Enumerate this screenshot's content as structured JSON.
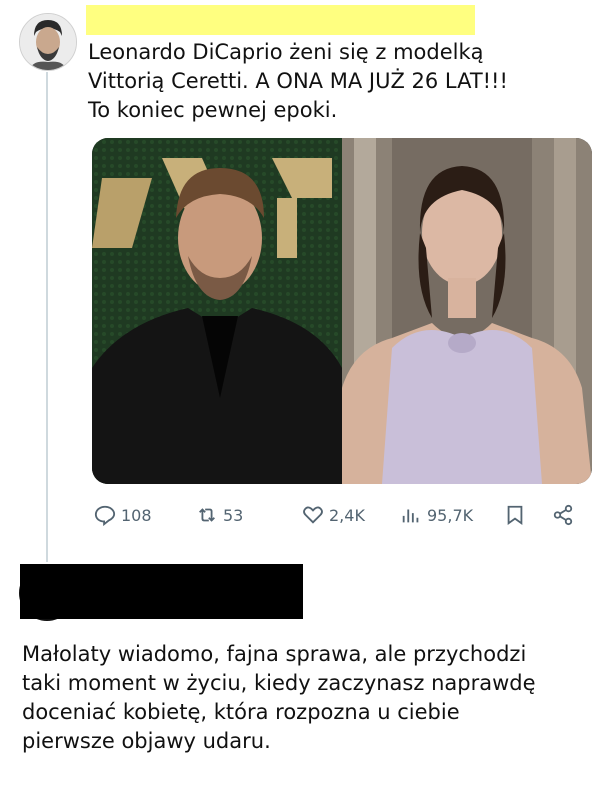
{
  "tweet": {
    "text": "Leonardo DiCaprio żeni się z modelką\nVittorią Ceretti. A ONA MA JUŻ 26 LAT!!!\nTo koniec pewnej epoki."
  },
  "actions": {
    "replies": "108",
    "reposts": "53",
    "likes": "2,4K",
    "views": "95,7K"
  },
  "reply": {
    "text": "Małolaty wiadomo, fajna sprawa, ale przychodzi\ntaki moment w życiu, kiedy zaczynasz naprawdę\ndoceniać kobietę, która rozpozna u ciebie\npierwsze objawy udaru."
  },
  "colors": {
    "highlight": "#ffff80",
    "icon": "#536471",
    "redaction": "#000000"
  }
}
